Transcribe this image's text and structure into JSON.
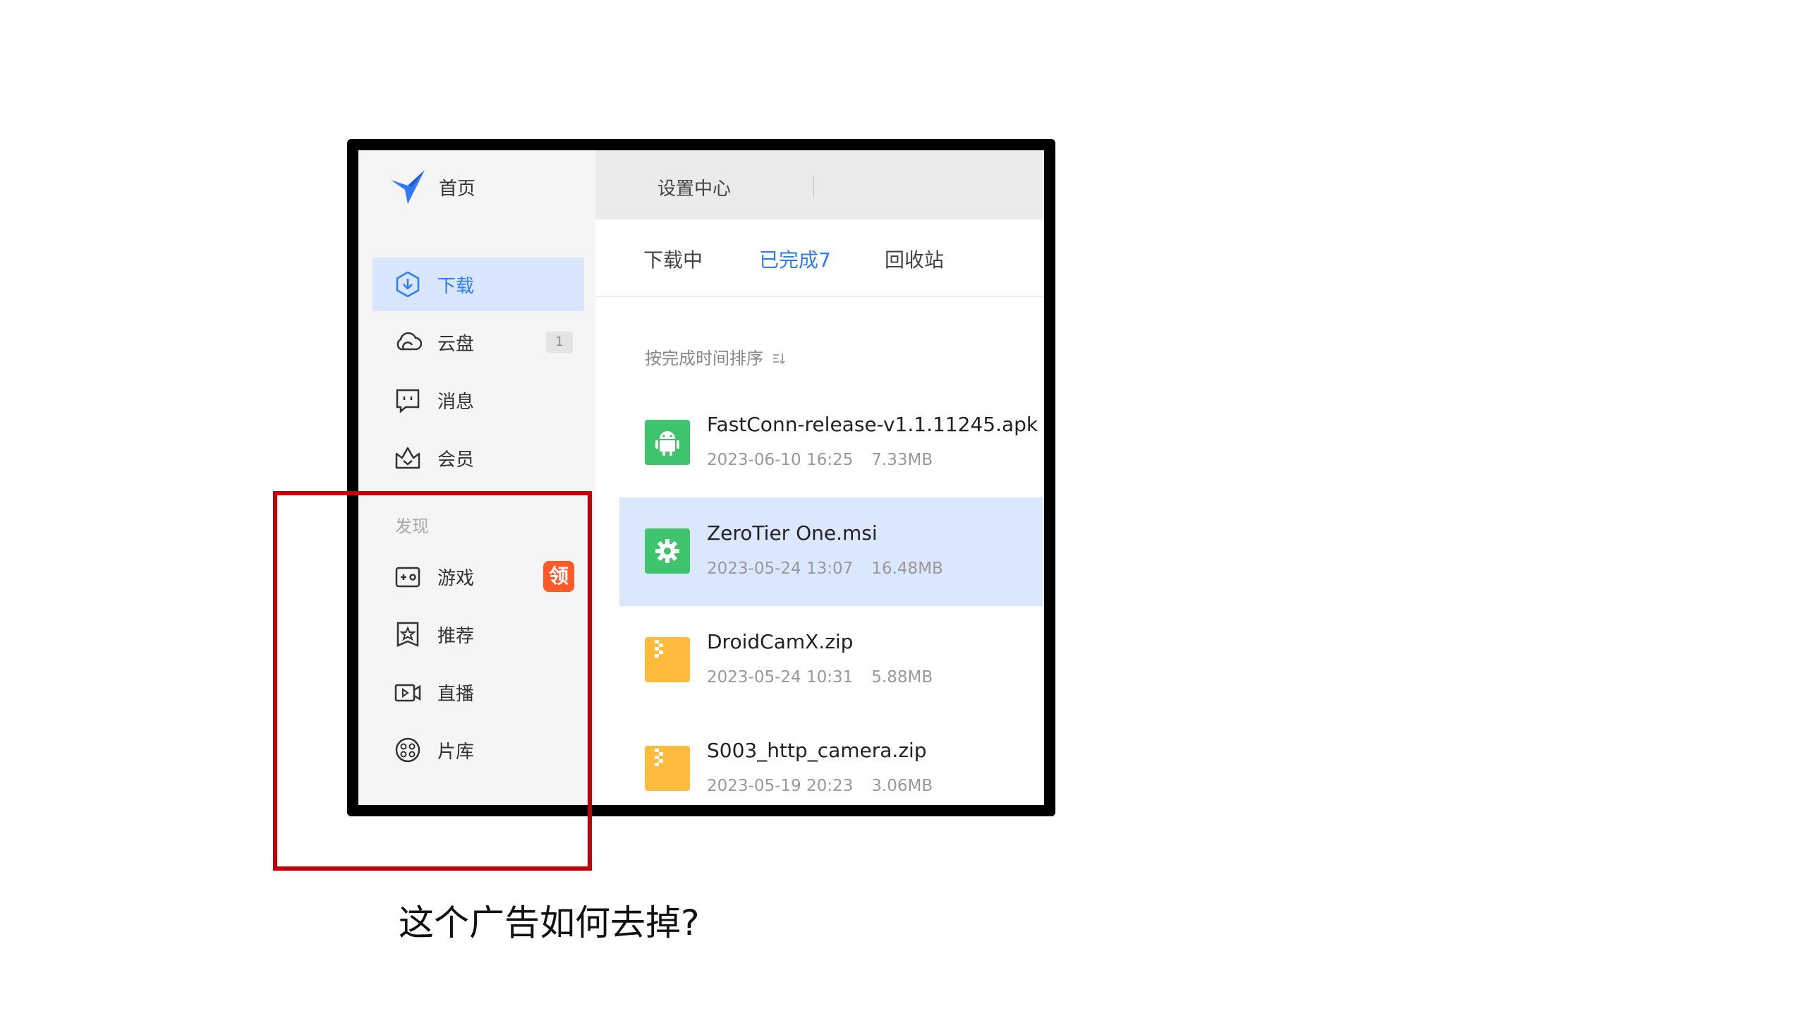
{
  "sidebar": {
    "home_label": "首页",
    "items": [
      {
        "label": "下载",
        "icon": "download-icon",
        "active": true
      },
      {
        "label": "云盘",
        "icon": "cloud-icon",
        "badge": "1"
      },
      {
        "label": "消息",
        "icon": "message-icon"
      },
      {
        "label": "会员",
        "icon": "crown-icon"
      }
    ],
    "discover_title": "发现",
    "discover_items": [
      {
        "label": "游戏",
        "icon": "gamepad-icon",
        "badge": "领"
      },
      {
        "label": "推荐",
        "icon": "star-bookmark-icon"
      },
      {
        "label": "直播",
        "icon": "video-camera-icon"
      },
      {
        "label": "片库",
        "icon": "film-reel-icon"
      }
    ]
  },
  "titlebar": {
    "settings_label": "设置中心"
  },
  "tabs": [
    {
      "label": "下载中",
      "active": false
    },
    {
      "label": "已完成7",
      "active": true
    },
    {
      "label": "回收站",
      "active": false
    }
  ],
  "sort_label": "按完成时间排序",
  "files": [
    {
      "name": "FastConn-release-v1.1.11245.apk",
      "date": "2023-06-10 16:25",
      "size": "7.33MB",
      "icon": "android-icon",
      "color": "#3ec46d"
    },
    {
      "name": "ZeroTier One.msi",
      "date": "2023-05-24 13:07",
      "size": "16.48MB",
      "icon": "gear-icon",
      "color": "#3ec46d",
      "selected": true
    },
    {
      "name": "DroidCamX.zip",
      "date": "2023-05-24 10:31",
      "size": "5.88MB",
      "icon": "zip-icon",
      "color": "#ffbc3c"
    },
    {
      "name": "S003_http_camera.zip",
      "date": "2023-05-19 20:23",
      "size": "3.06MB",
      "icon": "zip-icon",
      "color": "#ffbc3c"
    }
  ],
  "question": "这个广告如何去掉?",
  "colors": {
    "accent": "#2f7bff",
    "highlight": "#c0000b",
    "ad_badge": "#ff5a2a"
  }
}
